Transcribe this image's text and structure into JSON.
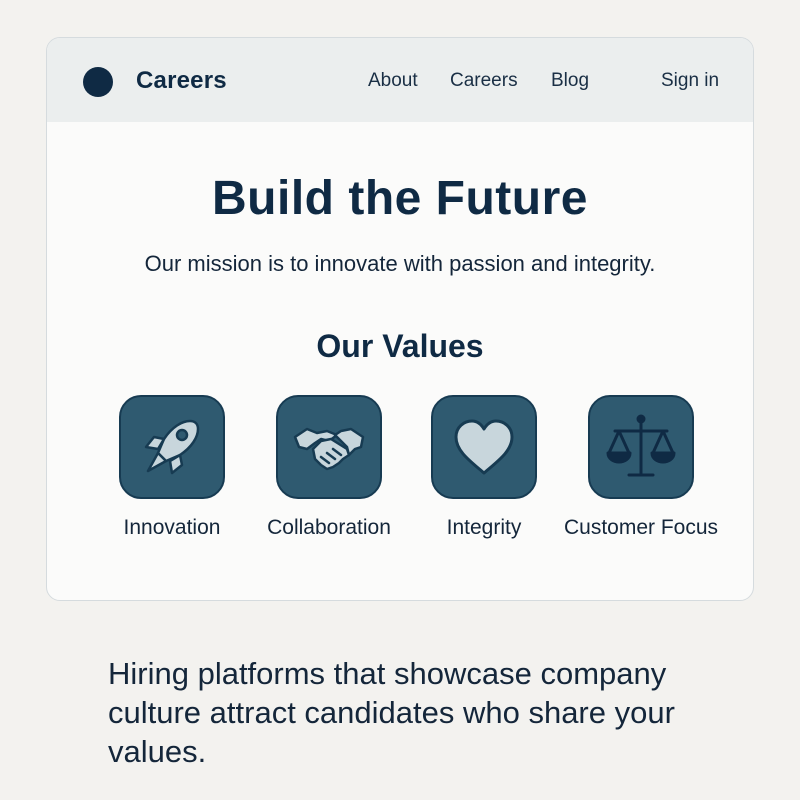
{
  "header": {
    "brand": "Careers",
    "nav": [
      "About",
      "Careers",
      "Blog"
    ],
    "sign_in": "Sign in"
  },
  "hero": {
    "title": "Build the Future",
    "subtitle": "Our mission is to innovate with passion and integrity."
  },
  "values": {
    "heading": "Our Values",
    "items": [
      {
        "label": "Innovation",
        "icon": "rocket-icon"
      },
      {
        "label": "Collaboration",
        "icon": "handshake-icon"
      },
      {
        "label": "Integrity",
        "icon": "heart-icon"
      },
      {
        "label": "Customer Focus",
        "icon": "scales-icon"
      }
    ]
  },
  "caption": "Hiring platforms that showcase company culture attract candidates who share your values.",
  "colors": {
    "primary": "#0f2a44",
    "tile": "#2f5a70",
    "icon_fill": "#c8d6dc",
    "page_bg": "#f3f2ef"
  }
}
